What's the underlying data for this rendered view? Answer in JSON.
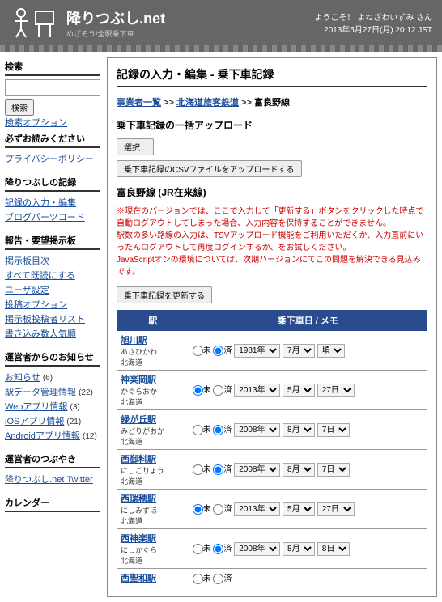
{
  "header": {
    "site_title": "降りつぶし.net",
    "tagline": "めざそう!全駅乗下車",
    "welcome": "ようこそ！ よねざわいずみ さん",
    "datetime": "2013年5月27日(月) 20:12 JST"
  },
  "sidebar": {
    "search": {
      "heading": "検索",
      "button": "検索",
      "options": "検索オプション"
    },
    "mustread": {
      "heading": "必ずお読みください",
      "items": [
        "プライバシーポリシー"
      ]
    },
    "records": {
      "heading": "降りつぶしの記録",
      "items": [
        "記録の入力・編集",
        "ブログパーツコード"
      ]
    },
    "board": {
      "heading": "報告・要望掲示板",
      "items": [
        "掲示板目次",
        "すべて既読にする",
        "ユーザ設定",
        "投稿オプション",
        "掲示板投稿者リスト",
        "書き込み数人気順"
      ]
    },
    "admin": {
      "heading": "運営者からのお知らせ",
      "items": [
        {
          "label": "お知らせ",
          "count": 6
        },
        {
          "label": "駅データ管理情報",
          "count": 22
        },
        {
          "label": "Webアプリ情報",
          "count": 3
        },
        {
          "label": "iOSアプリ情報",
          "count": 21
        },
        {
          "label": "Androidアプリ情報",
          "count": 12
        }
      ]
    },
    "tweets": {
      "heading": "運営者のつぶやき",
      "items": [
        "降りつぶし.net Twitter"
      ]
    },
    "calendar": {
      "heading": "カレンダー"
    }
  },
  "main": {
    "title": "記録の入力・編集 - 乗下車記録",
    "breadcrumb": {
      "a": "事業者一覧",
      "b": "北海道旅客鉄道",
      "c": "富良野線",
      "sep": ">>"
    },
    "upload": {
      "heading": "乗下車記録の一括アップロード",
      "choose": "選択...",
      "submit": "乗下車記録のCSVファイルをアップロードする"
    },
    "line": {
      "heading": "富良野線 (JR在来線)",
      "warning": "※現在のバージョンでは、ここで入力して「更新する」ボタンをクリックした時点で自動ログアウトしてしまった場合、入力内容を保持することができません。\n駅数の多い路線の入力は、TSVアップロード機能をご利用いただくか、入力直前にいったんログアウトして再度ログインするか、をお試しください。\nJavaScriptオンの環境については、次期バージョンにてこの問題を解決できる見込みです。",
      "update_btn": "乗下車記録を更新する"
    },
    "table": {
      "th_station": "駅",
      "th_date": "乗下車日 / メモ",
      "radio_mi": "未",
      "radio_sumi": "済",
      "yr_suffix": "年",
      "mo_suffix": "月",
      "dy_suffix": "日",
      "koro": "頃",
      "rows": [
        {
          "name": "旭川駅",
          "reading": "あさひかわ",
          "pref": "北海道",
          "status": "済",
          "year": "1981",
          "month": "7",
          "day": "",
          "approx": true
        },
        {
          "name": "神楽岡駅",
          "reading": "かぐらおか",
          "pref": "北海道",
          "status": "未",
          "year": "2013",
          "month": "5",
          "day": "27",
          "approx": false
        },
        {
          "name": "緑が丘駅",
          "reading": "みどりがおか",
          "pref": "北海道",
          "status": "済",
          "year": "2008",
          "month": "8",
          "day": "7",
          "approx": false
        },
        {
          "name": "西御料駅",
          "reading": "にしごりょう",
          "pref": "北海道",
          "status": "済",
          "year": "2008",
          "month": "8",
          "day": "7",
          "approx": false
        },
        {
          "name": "西瑞穂駅",
          "reading": "にしみずほ",
          "pref": "北海道",
          "status": "未",
          "year": "2013",
          "month": "5",
          "day": "27",
          "approx": false
        },
        {
          "name": "西神楽駅",
          "reading": "にしかぐら",
          "pref": "北海道",
          "status": "済",
          "year": "2008",
          "month": "8",
          "day": "8",
          "approx": false
        },
        {
          "name": "西聖和駅",
          "reading": "",
          "pref": "",
          "status": "",
          "year": "",
          "month": "",
          "day": "",
          "approx": false
        }
      ]
    }
  }
}
